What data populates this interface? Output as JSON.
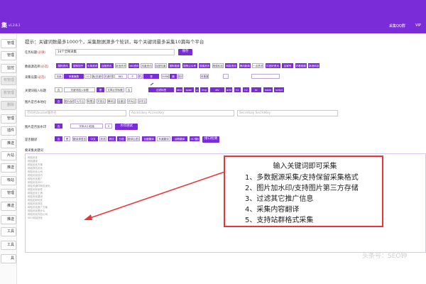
{
  "topbar": {
    "brand": "集",
    "version": "v1.2.6.1",
    "right_1": "采集QQ群",
    "right_2": "VIP"
  },
  "sidebar": {
    "items": [
      {
        "label": "管理",
        "disabled": false
      },
      {
        "label": "管理",
        "disabled": false
      },
      {
        "label": "监控",
        "disabled": false
      },
      {
        "label": "权管理",
        "disabled": true
      },
      {
        "label": "账管理",
        "disabled": true
      },
      {
        "label": "删除",
        "disabled": true
      },
      {
        "label": "管理",
        "disabled": false
      },
      {
        "label": "插件",
        "disabled": false
      },
      {
        "label": "推送",
        "disabled": false
      },
      {
        "label": "片站",
        "disabled": false
      },
      {
        "label": "推送",
        "disabled": false
      },
      {
        "label": "吸站",
        "disabled": false
      },
      {
        "label": "管理",
        "disabled": false
      },
      {
        "label": "推送",
        "disabled": false
      },
      {
        "label": "推送",
        "disabled": false
      },
      {
        "label": "工具",
        "disabled": false
      },
      {
        "label": "工具",
        "disabled": false
      },
      {
        "label": "具",
        "disabled": false
      }
    ]
  },
  "tip": "提示：关键词数最多1000个，采集数据源多个轮训，每个关键词最多采集10篇每个平台",
  "task_name": {
    "label": "任务标题",
    "required": "(必填)",
    "value": "14个全网采集",
    "save": "保存"
  },
  "datasource": {
    "label": "数据源选择",
    "required": "(必选)",
    "options": [
      "搜狗资讯",
      "搜狗知乎",
      "头条资讯",
      "百度资讯",
      "新浪资讯",
      "360资讯",
      "凤凰资讯",
      "百度知道",
      "搜狗视频",
      "搜狗公众号",
      "搜狐资讯",
      "搜狐科技",
      "网易资讯",
      "腾讯新闻",
      "一点资讯",
      "抖音好资讯",
      "百家号",
      "好看视频",
      "新浪科技"
    ]
  },
  "collect_settings": {
    "label": "采集设置",
    "required": "(必选)",
    "items": [
      "页面",
      "采集篇数",
      "10",
      "篇/关键词",
      "关键词数",
      "881",
      "个",
      "是否伪原创",
      "是",
      "3988",
      "篇",
      "图片数量",
      "采集篇数",
      "",
      ""
    ]
  },
  "keyword_insert": {
    "label": "关键词插入标题",
    "items": [
      "否",
      "关键词插入标题",
      "是",
      "文章必须标题",
      "否",
      "过滤标签",
      "strong",
      "span",
      "p",
      "img",
      "div",
      "article",
      "h1",
      "h2",
      "br",
      "table",
      "script"
    ]
  },
  "image_localize": {
    "label": "图片是否本地化",
    "items": [
      "否",
      "图片保存",
      "七牛云",
      "阿里云",
      "又拍云",
      "腾讯云",
      "百度云",
      "华为云",
      "京东云"
    ]
  },
  "storage": {
    "bucket_placeholder": "空间名/bucket服务名",
    "access_placeholder": "AccessKey",
    "secret_placeholder": "SecretKey",
    "access_prefix": "Accesskey",
    "secret_prefix": "Secretkey"
  },
  "watermark": {
    "label": "图片是否加水印",
    "items": [
      "否",
      "字体大小粒值",
      "5"
    ],
    "button": "水印测试"
  },
  "translate": {
    "label": "是否翻译",
    "items": [
      "否",
      "是",
      "翻译源语言",
      "中文",
      "英语",
      "韩文",
      "日语",
      "翻译后语言",
      "百度翻译",
      "有道翻译",
      "谷歌翻译",
      "147翻译"
    ],
    "button": "接口检测"
  },
  "keyword_list": {
    "label": "要采集关键词",
    "items": [
      "网站优化",
      "网站建设",
      "网站优化方案",
      "网站排名优化",
      "网站优化公司",
      "网站优化技巧",
      "网站优化推广",
      "网站优化SEO",
      "网站关键词排名优化",
      "网站优化软件",
      "网站优化工具",
      "网站优化建设",
      "网站如何优化",
      "网站优化排名",
      "网站优化推广方案",
      "网站优化是什么",
      "网站优化外包公司",
      "SEO网站优化"
    ]
  },
  "callout": {
    "title": "输入关键词即可采集",
    "items": [
      "1、多数据源采集/支持保留采集格式",
      "2、图片加水印/支持图片第三方存储",
      "3、过滤其它推广信息",
      "4、采集内容翻译",
      "5、支持站群格式采集"
    ]
  },
  "watermark_text": "头条号：SEO钟"
}
